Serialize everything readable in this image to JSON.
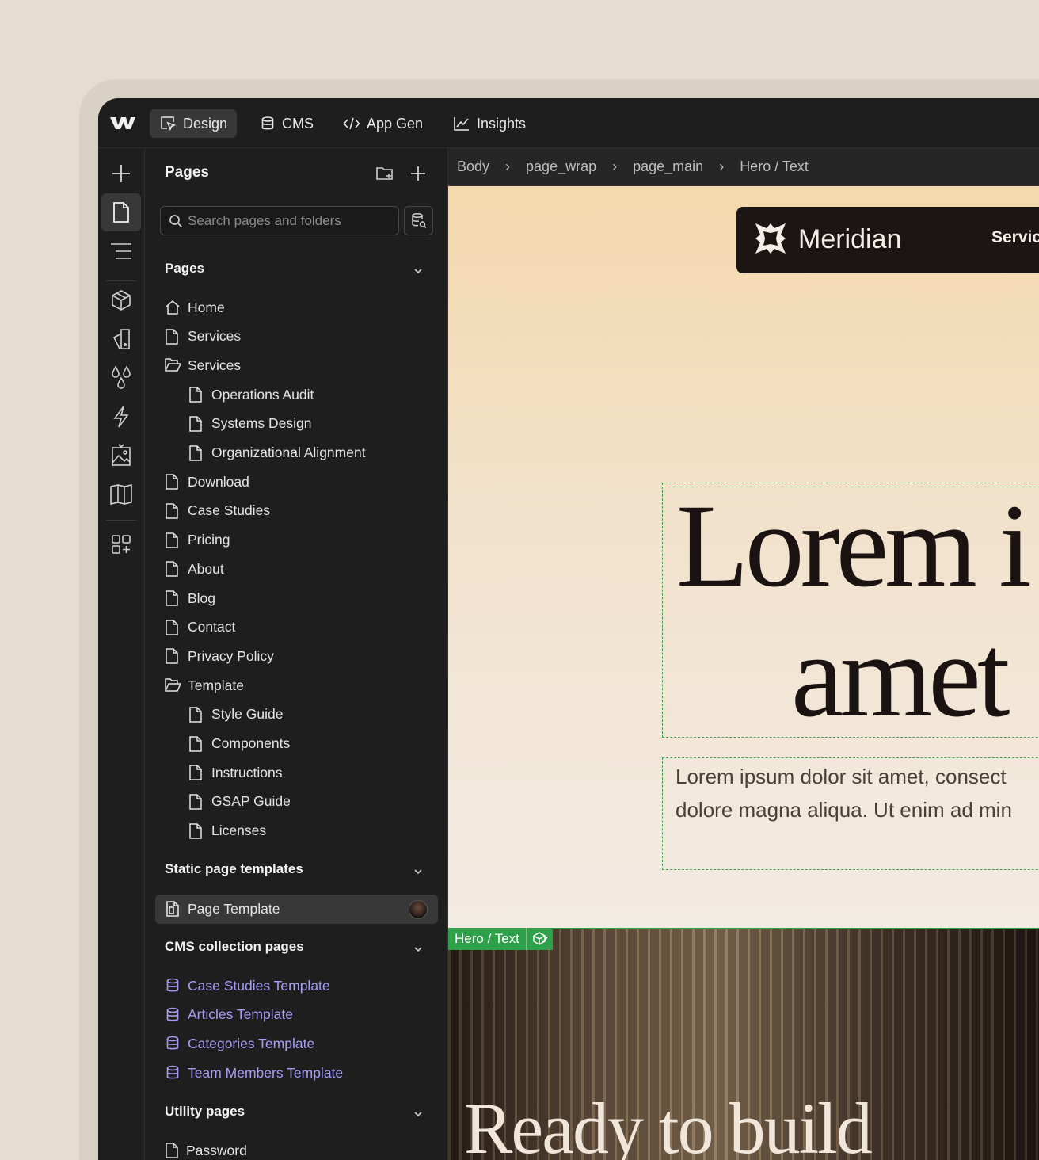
{
  "topbar": {
    "tabs": [
      {
        "label": "Design",
        "icon": "cursor-box-icon",
        "active": true
      },
      {
        "label": "CMS",
        "icon": "database-icon"
      },
      {
        "label": "App Gen",
        "icon": "code-icon"
      },
      {
        "label": "Insights",
        "icon": "chart-line-icon"
      }
    ]
  },
  "rail": [
    "plus-icon",
    "page-icon",
    "navigator-icon",
    "components-icon",
    "styles-icon",
    "variables-icon",
    "interactions-icon",
    "assets-icon",
    "library-icon",
    "apps-icon"
  ],
  "panel": {
    "title": "Pages",
    "search_placeholder": "Search pages and folders",
    "sections": {
      "pages": "Pages",
      "static": "Static page templates",
      "cms": "CMS collection pages",
      "utility": "Utility pages"
    },
    "pages": [
      {
        "label": "Home",
        "icon": "home-icon",
        "level": 0
      },
      {
        "label": "Services",
        "icon": "page-icon",
        "level": 0
      },
      {
        "label": "Services",
        "icon": "folder-open-icon",
        "level": 0
      },
      {
        "label": "Operations Audit",
        "icon": "page-icon",
        "level": 1
      },
      {
        "label": "Systems Design",
        "icon": "page-icon",
        "level": 1
      },
      {
        "label": "Organizational Alignment",
        "icon": "page-icon",
        "level": 1
      },
      {
        "label": "Download",
        "icon": "page-icon",
        "level": 0
      },
      {
        "label": "Case Studies",
        "icon": "page-icon",
        "level": 0
      },
      {
        "label": "Pricing",
        "icon": "page-icon",
        "level": 0
      },
      {
        "label": "About",
        "icon": "page-icon",
        "level": 0
      },
      {
        "label": "Blog",
        "icon": "page-icon",
        "level": 0
      },
      {
        "label": "Contact",
        "icon": "page-icon",
        "level": 0
      },
      {
        "label": "Privacy Policy",
        "icon": "page-icon",
        "level": 0
      },
      {
        "label": "Template",
        "icon": "folder-open-icon",
        "level": 0
      },
      {
        "label": "Style Guide",
        "icon": "page-icon",
        "level": 1
      },
      {
        "label": "Components",
        "icon": "page-icon",
        "level": 1
      },
      {
        "label": "Instructions",
        "icon": "page-icon",
        "level": 1
      },
      {
        "label": "GSAP Guide",
        "icon": "page-icon",
        "level": 1
      },
      {
        "label": "Licenses",
        "icon": "page-icon",
        "level": 1
      }
    ],
    "static_templates": [
      {
        "label": "Page Template",
        "icon": "template-page-icon",
        "selected": true
      }
    ],
    "cms_pages": [
      {
        "label": "Case Studies Template"
      },
      {
        "label": "Articles Template"
      },
      {
        "label": "Categories Template"
      },
      {
        "label": "Team Members Template"
      }
    ],
    "utility_pages": [
      {
        "label": "Password"
      }
    ]
  },
  "breadcrumb": [
    "Body",
    "page_wrap",
    "page_main",
    "Hero / Text"
  ],
  "breadcrumb_sep": "›",
  "site": {
    "brand": "Meridian",
    "nav_link": "Servic",
    "hero_line1": "Lorem i",
    "hero_line2": "amet",
    "sub_line1": "Lorem ipsum dolor sit amet, consect",
    "sub_line2": "dolore magna aliqua. Ut enim ad min",
    "selection_label": "Hero / Text",
    "cta_heading": "Ready to build"
  },
  "colors": {
    "accent_green": "#2fa04a",
    "cms_purple": "#a99cf5",
    "app_bg": "#1e1e1e"
  }
}
